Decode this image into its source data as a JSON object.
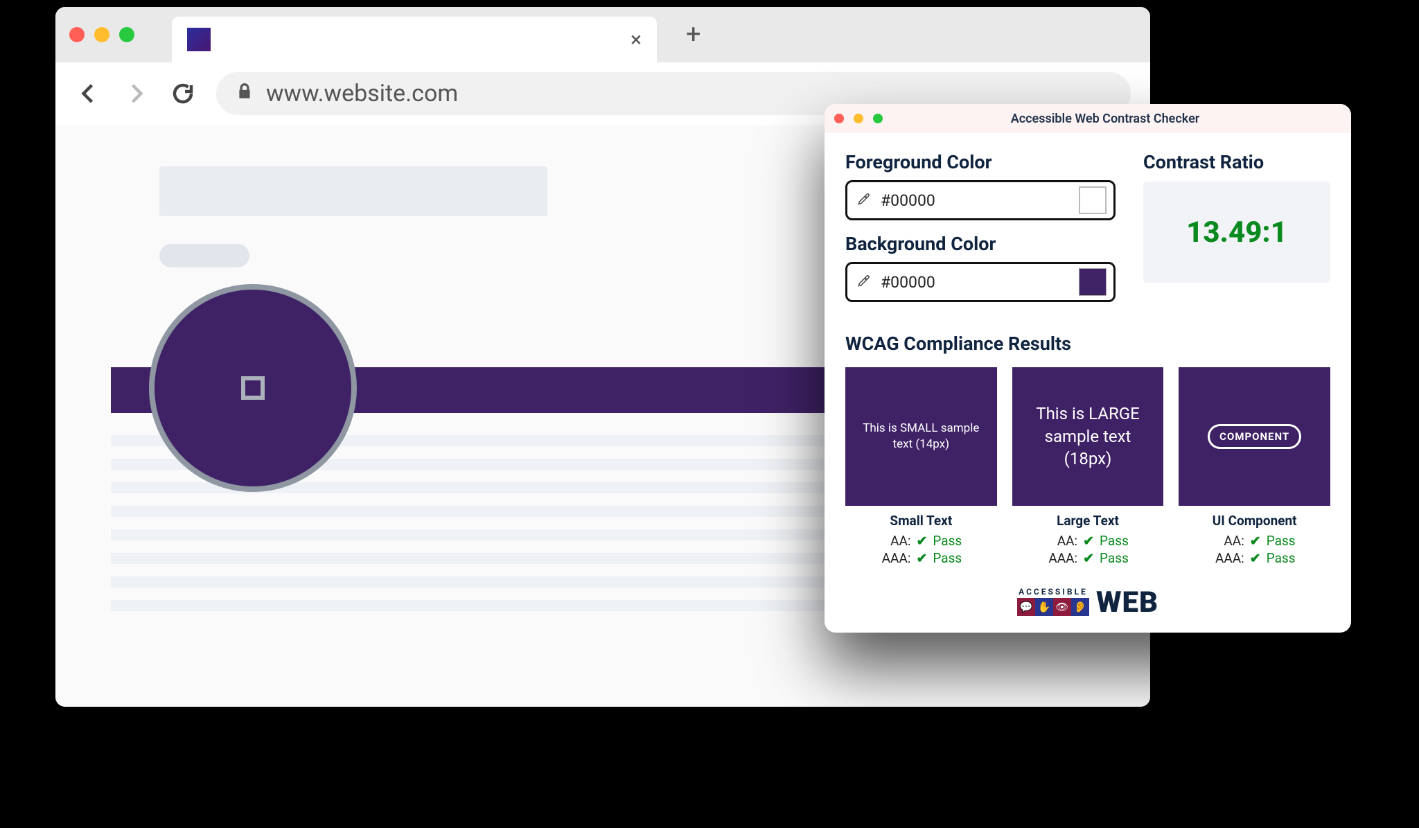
{
  "browser": {
    "url": "www.website.com"
  },
  "popup": {
    "title": "Accessible Web Contrast Checker",
    "foreground": {
      "label": "Foreground Color",
      "value": "#00000",
      "swatch": "#ffffff"
    },
    "background": {
      "label": "Background Color",
      "value": "#00000",
      "swatch": "#3f2266"
    },
    "ratio": {
      "label": "Contrast Ratio",
      "value": "13.49:1"
    },
    "results": {
      "title": "WCAG Compliance Results",
      "cards": [
        {
          "sample": "This is SMALL sample text (14px)",
          "label": "Small Text",
          "aa": "Pass",
          "aaa": "Pass"
        },
        {
          "sample": "This is LARGE sample text (18px)",
          "label": "Large Text",
          "aa": "Pass",
          "aaa": "Pass"
        },
        {
          "sample": "COMPONENT",
          "label": "UI Component",
          "aa": "Pass",
          "aaa": "Pass"
        }
      ],
      "levels": {
        "aa": "AA:",
        "aaa": "AAA:"
      }
    },
    "footer": {
      "small": "ACCESSIBLE",
      "big": "WEB"
    }
  }
}
